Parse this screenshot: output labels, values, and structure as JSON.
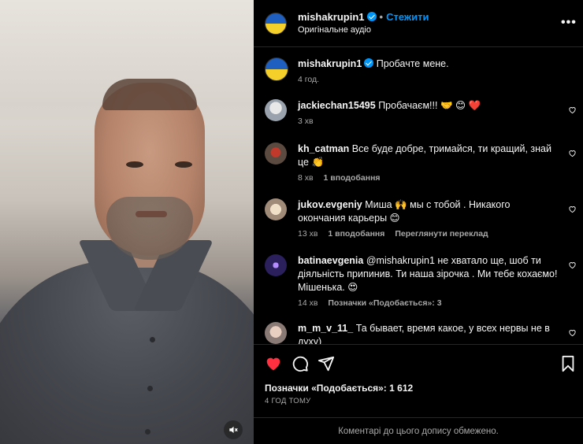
{
  "post": {
    "username": "mishakrupin1",
    "follow_label": "Стежити",
    "audio_label": "Оригінальне аудіо",
    "more_label": "•••",
    "caption_username": "mishakrupin1",
    "caption_text": "Пробачте мене.",
    "caption_time": "4 год."
  },
  "comments": [
    {
      "username": "jackiechan15495",
      "text": "Пробачаєм!!! 🤝 😊 ❤️",
      "time": "3 хв",
      "likes": "",
      "extra": ""
    },
    {
      "username": "kh_catman",
      "text": "Все буде добре, тримайся, ти кращий, знай це 👏",
      "time": "8 хв",
      "likes": "1 вподобання",
      "extra": ""
    },
    {
      "username": "jukov.evgeniy",
      "text": "Миша 🙌 мы с тобой . Никакого окончания карьеры 😊",
      "time": "13 хв",
      "likes": "1 вподобання",
      "extra": "Переглянути переклад"
    },
    {
      "username": "batinaevgenia",
      "text": "@mishakrupin1 не хватало ще, шоб ти діяльність припинив. Ти наша зірочка . Ми тебе кохаємо! Мішенька. 😍",
      "time": "14 хв",
      "likes": "Позначки «Подобається»: 3",
      "extra": ""
    },
    {
      "username": "m_m_v_11_",
      "text": "Та бывает, время какое, у всех нервы не в духу)",
      "time": "",
      "likes": "",
      "extra": ""
    }
  ],
  "actions": {
    "likes_text": "Позначки «Подобається»: 1 612",
    "time_text": "4 ГОД ТОМУ",
    "like_color": "#ff3040"
  },
  "footer": {
    "restricted_text": "Коментарі до цього допису обмежено."
  },
  "icons": [
    "heart-icon",
    "comment-icon",
    "share-icon",
    "bookmark-icon",
    "mute-icon",
    "verified-icon",
    "more-icon"
  ]
}
